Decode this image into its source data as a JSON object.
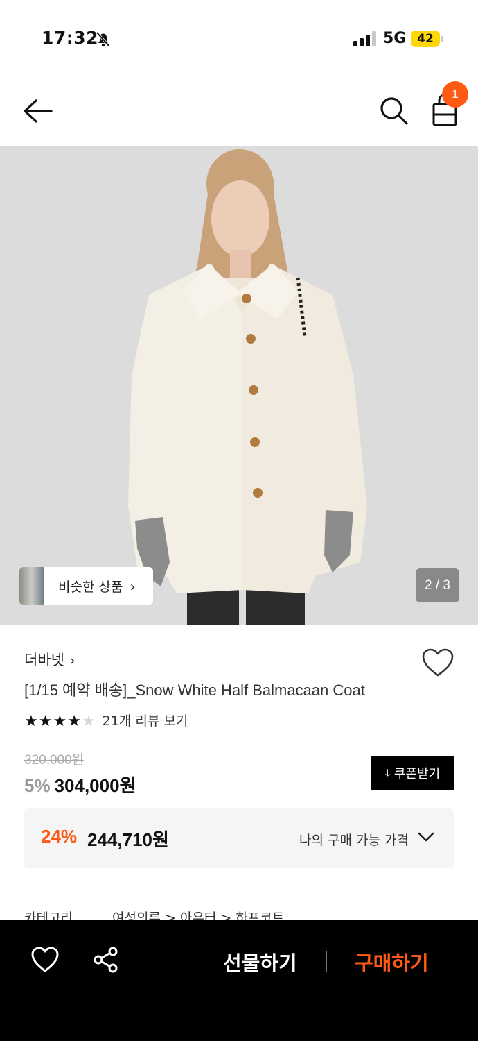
{
  "status_bar": {
    "time": "17:32",
    "network": "5G",
    "battery": "42"
  },
  "header": {
    "cart_count": "1"
  },
  "gallery": {
    "similar_label": "비슷한 상품",
    "page_indicator": "2 / 3"
  },
  "product": {
    "brand": "더바넷",
    "title": "[1/15 예약 배송]_Snow White Half Balmacaan Coat",
    "rating_stars": 4,
    "review_link": "21개 리뷰 보기",
    "original_price": "320,000원",
    "discount": "5%",
    "price": "304,000원",
    "coupon_label": "쿠폰받기",
    "best_discount": "24%",
    "best_price": "244,710원",
    "best_price_label": "나의 구매 가능 가격",
    "category_label": "카테고리",
    "category_path": "여성의류 > 아우터 > 하프코트"
  },
  "bottom_bar": {
    "gift_label": "선물하기",
    "buy_label": "구매하기"
  },
  "colors": {
    "accent": "#ff5a14",
    "dark": "#000000",
    "box": "#f5f5f5"
  },
  "icons": [
    "back-arrow-icon",
    "search-icon",
    "shopping-bag-icon",
    "heart-icon",
    "share-icon",
    "chevron-down-icon",
    "download-icon",
    "bell-slash-icon",
    "signal-icon"
  ]
}
